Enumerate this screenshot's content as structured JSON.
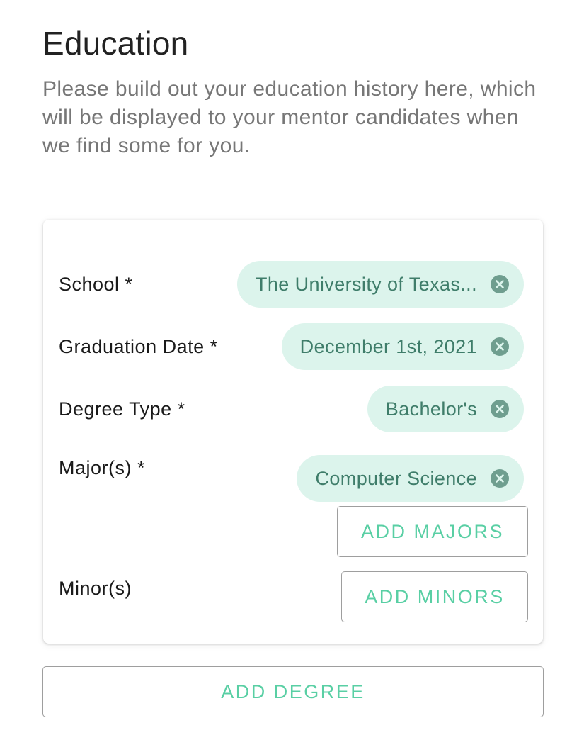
{
  "education": {
    "title": "Education",
    "description": "Please build out your education history here, which will be displayed to your mentor candidates when we find some for you.",
    "degree": {
      "school": {
        "label": "School *",
        "value": "The University of Texas..."
      },
      "graduation_date": {
        "label": "Graduation Date *",
        "value": "December 1st, 2021"
      },
      "degree_type": {
        "label": "Degree Type *",
        "value": "Bachelor's"
      },
      "majors": {
        "label": "Major(s) *",
        "values": [
          "Computer Science"
        ],
        "add_label": "ADD MAJORS"
      },
      "minors": {
        "label": "Minor(s)",
        "add_label": "ADD MINORS"
      }
    },
    "add_degree_label": "ADD DEGREE"
  },
  "colors": {
    "accent": "#59cfa4",
    "chip_background": "#dcf4ec",
    "chip_text": "#3f7d6a",
    "chip_remove_icon": "#6f9e8f"
  },
  "icons": {
    "chip_remove": "close-circle-icon"
  }
}
